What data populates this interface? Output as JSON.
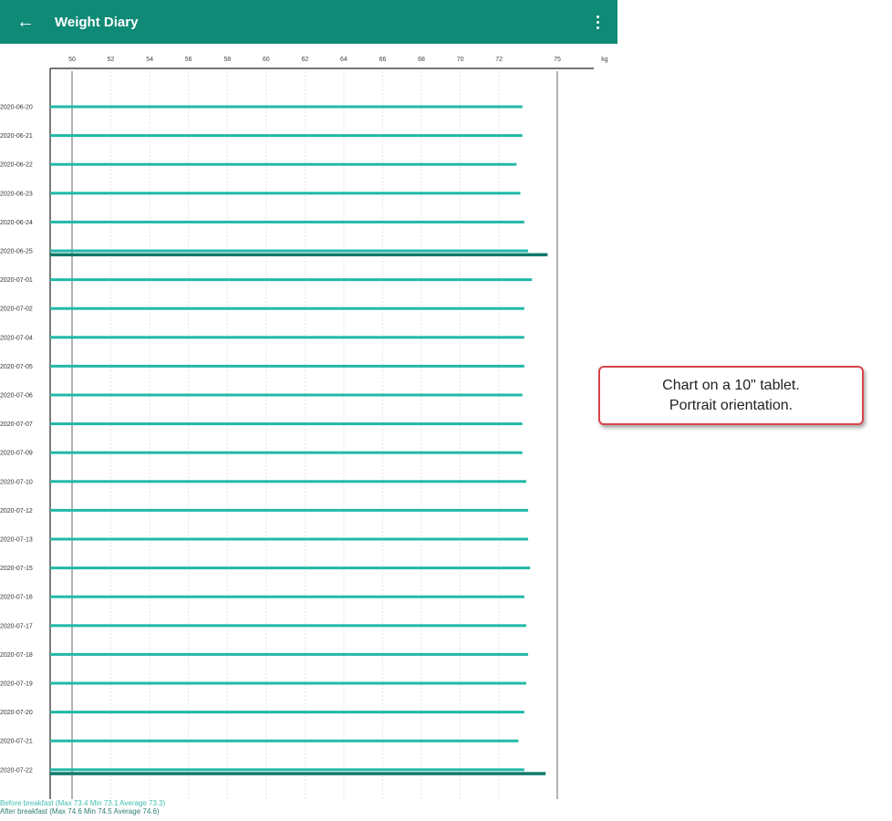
{
  "app": {
    "title": "Weight Diary",
    "back_icon": "arrow-left-icon",
    "menu_icon": "more-vert-icon",
    "bar_color": "#0f8a76"
  },
  "callout": {
    "line1": "Chart on a 10\" tablet.",
    "line2": "Portrait orientation."
  },
  "footer": {
    "before": "Before breakfast  (Max 73.4  Min 73.1  Average 73.3)",
    "after": "After breakfast  (Max 74.6  Min 74.5  Average 74.6)"
  },
  "chart_data": {
    "type": "bar",
    "orientation": "horizontal",
    "x_unit": "kg",
    "xlim": [
      50,
      75
    ],
    "x_ticks": [
      "50",
      "52",
      "54",
      "56",
      "58",
      "60",
      "62",
      "64",
      "66",
      "68",
      "70",
      "72",
      "75"
    ],
    "grid": true,
    "colors": {
      "before": "#22b8a8",
      "after": "#0f7a6a"
    },
    "categories": [
      "2020-06-20",
      "2020-06-21",
      "2020-06-22",
      "2020-06-23",
      "2020-06-24",
      "2020-06-25",
      "2020-07-01",
      "2020-07-02",
      "2020-07-04",
      "2020-07-05",
      "2020-07-06",
      "2020-07-07",
      "2020-07-09",
      "2020-07-10",
      "2020-07-12",
      "2020-07-13",
      "2020-07-15",
      "2020-07-16",
      "2020-07-17",
      "2020-07-18",
      "2020-07-19",
      "2020-07-20",
      "2020-07-21",
      "2020-07-22"
    ],
    "series": [
      {
        "name": "Before breakfast",
        "values": [
          73.2,
          73.2,
          72.9,
          73.1,
          73.3,
          73.5,
          73.7,
          73.3,
          73.3,
          73.3,
          73.2,
          73.2,
          73.2,
          73.4,
          73.5,
          73.5,
          73.6,
          73.3,
          73.4,
          73.5,
          73.4,
          73.3,
          73.0,
          73.3
        ]
      },
      {
        "name": "After breakfast",
        "values": [
          null,
          null,
          null,
          null,
          null,
          74.5,
          null,
          null,
          null,
          null,
          null,
          null,
          null,
          null,
          null,
          null,
          null,
          null,
          null,
          null,
          null,
          null,
          null,
          74.4
        ]
      }
    ]
  }
}
